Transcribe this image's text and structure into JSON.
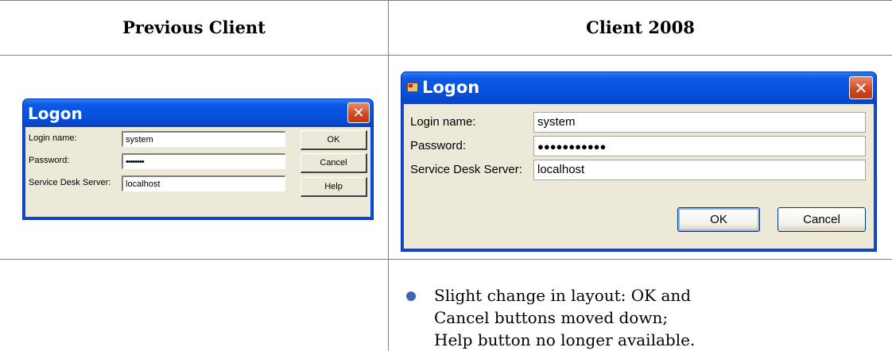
{
  "table": {
    "headers": [
      "Previous Client",
      "Client 2008"
    ],
    "note": "Slight change in layout: OK and Cancel buttons moved down; Help button no longer available."
  },
  "old_dialog": {
    "title": "Logon",
    "fields": [
      {
        "label": "Login name:",
        "value": "system"
      },
      {
        "label": "Password:",
        "value": "••••••••"
      },
      {
        "label": "Service Desk Server:",
        "value": "localhost"
      }
    ],
    "buttons": {
      "ok": "OK",
      "cancel": "Cancel",
      "help": "Help"
    }
  },
  "new_dialog": {
    "title": "Logon",
    "fields": [
      {
        "label": "Login name:",
        "value": "system"
      },
      {
        "label": "Password:",
        "value": "●●●●●●●●●●●"
      },
      {
        "label": "Service Desk Server:",
        "value": "localhost"
      }
    ],
    "buttons": {
      "ok": "OK",
      "cancel": "Cancel"
    }
  },
  "icons": {
    "close": "close-icon",
    "app": "app-window-icon"
  },
  "colors": {
    "titlebar": "#0552dc",
    "close_button": "#d0471f",
    "dialog_body": "#ece9d8",
    "bullet": "#3b66b8",
    "rule": "#7f7f7f"
  }
}
